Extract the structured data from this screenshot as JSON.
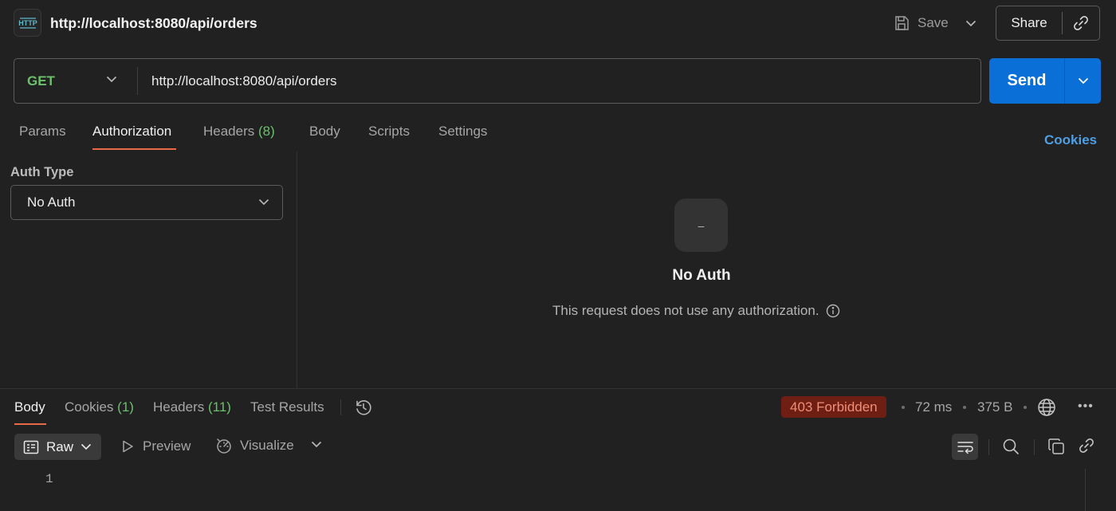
{
  "titlebar": {
    "badge": "HTTP",
    "title": "http://localhost:8080/api/orders",
    "save_label": "Save",
    "share_label": "Share"
  },
  "request": {
    "method": "GET",
    "url": "http://localhost:8080/api/orders",
    "send_label": "Send"
  },
  "tabs": {
    "params": "Params",
    "authorization": "Authorization",
    "headers": "Headers",
    "headers_count": "(8)",
    "body": "Body",
    "scripts": "Scripts",
    "settings": "Settings",
    "cookies_link": "Cookies"
  },
  "auth": {
    "type_label": "Auth Type",
    "type_value": "No Auth",
    "icon_glyph": "–",
    "title": "No Auth",
    "description": "This request does not use any authorization."
  },
  "response": {
    "tabs": {
      "body": "Body",
      "cookies": "Cookies",
      "cookies_count": "(1)",
      "headers": "Headers",
      "headers_count": "(11)",
      "test_results": "Test Results"
    },
    "status": "403 Forbidden",
    "time": "72 ms",
    "size": "375 B",
    "more": "•••",
    "format": "Raw",
    "preview": "Preview",
    "visualize": "Visualize",
    "line_number": "1"
  },
  "colors": {
    "background": "#212121",
    "accent_send": "#0b6fd8",
    "method_get": "#6bc16b",
    "tab_underline": "#e66a45",
    "status_error_bg": "#6e1e12",
    "status_error_fg": "#f08f78",
    "link": "#4d9fe6"
  },
  "icons": [
    "http-icon",
    "save-icon",
    "chevron-down-icon",
    "link-icon",
    "info-icon",
    "history-icon",
    "globe-icon",
    "more-icon",
    "raw-icon",
    "play-icon",
    "visualize-icon",
    "wrap-icon",
    "search-icon",
    "copy-icon"
  ]
}
